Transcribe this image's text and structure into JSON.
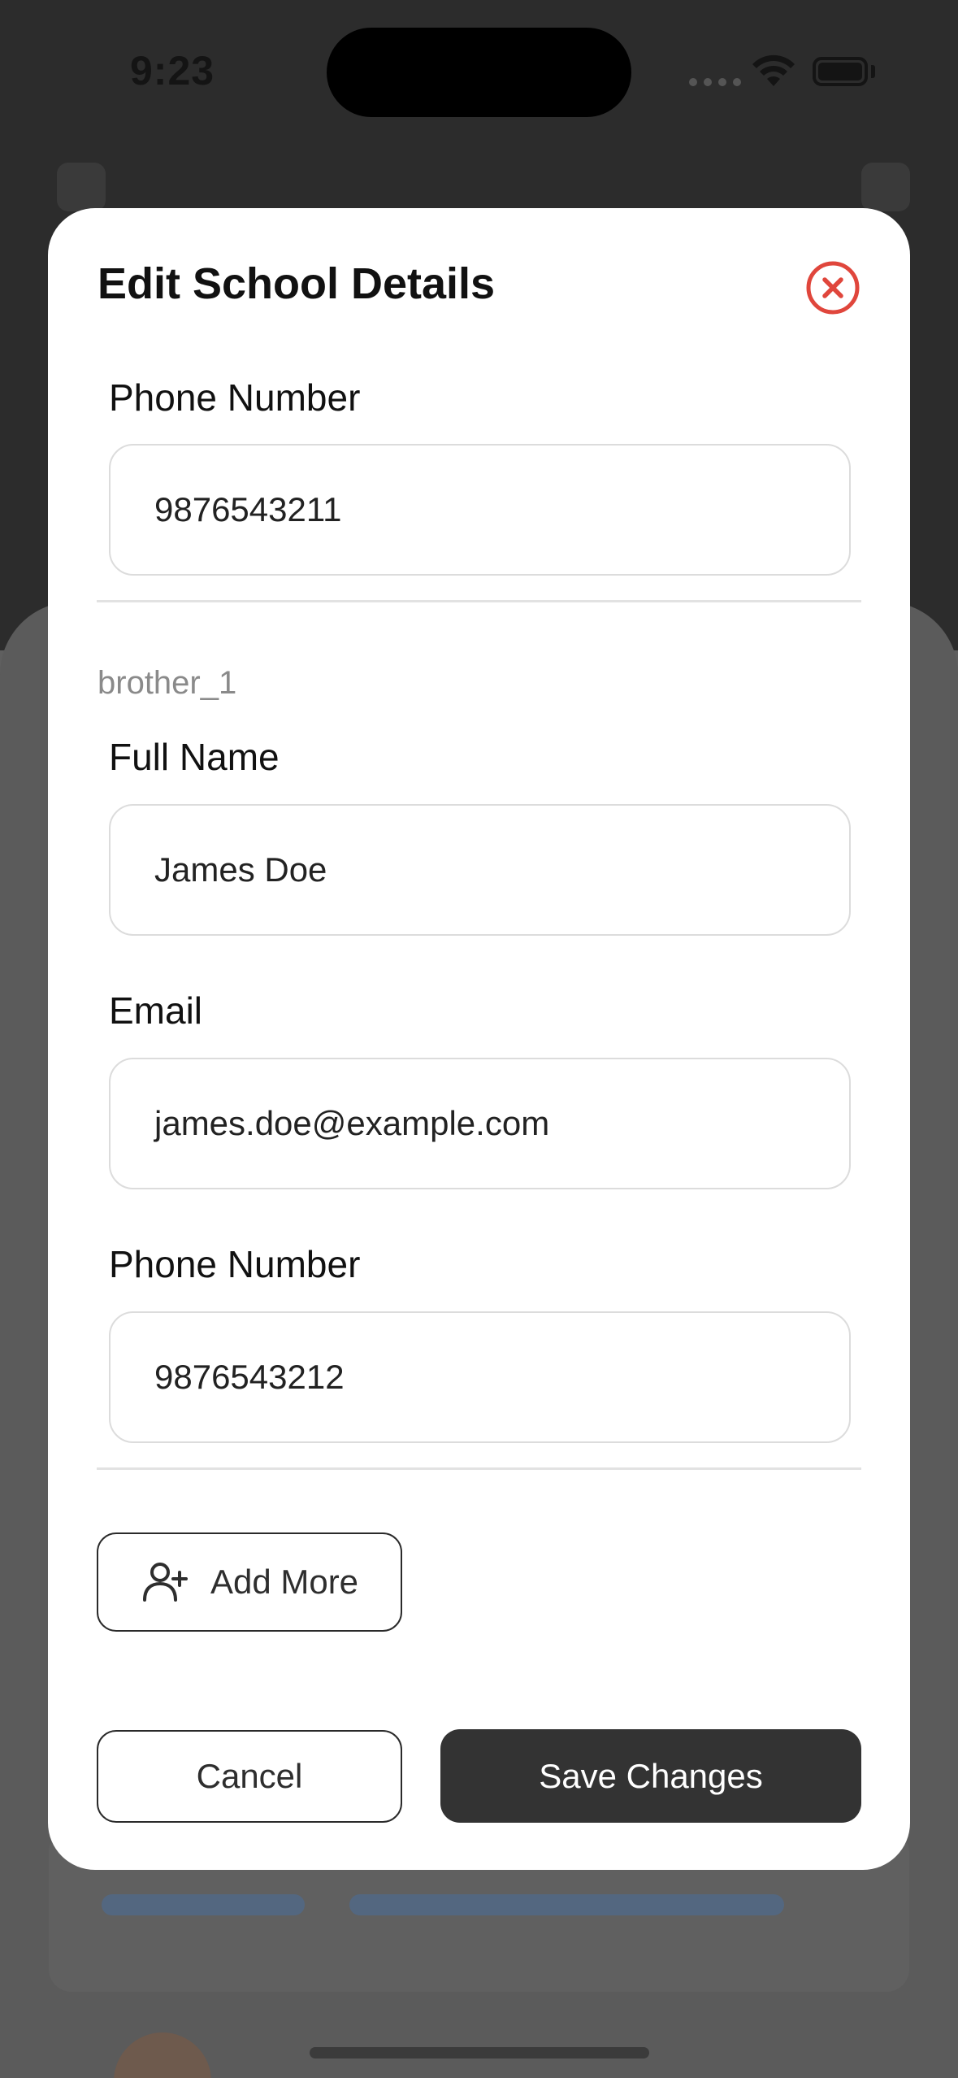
{
  "status_bar": {
    "time": "9:23"
  },
  "modal": {
    "title": "Edit School Details",
    "close_icon": "close-circle-icon",
    "accent_color": "#e0463c",
    "first_section": {
      "phone_label": "Phone Number",
      "phone_value": "9876543211"
    },
    "sibling": {
      "group_label": "brother_1",
      "full_name_label": "Full Name",
      "full_name_value": "James Doe",
      "email_label": "Email",
      "email_value": "james.doe@example.com",
      "phone_label": "Phone Number",
      "phone_value": "9876543212"
    },
    "add_more": {
      "icon": "add-user-icon",
      "label": "Add More"
    },
    "cancel_label": "Cancel",
    "save_label": "Save Changes"
  }
}
